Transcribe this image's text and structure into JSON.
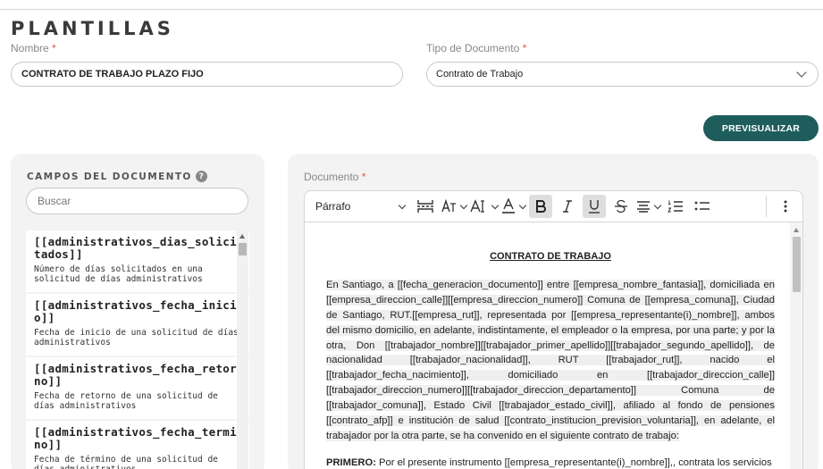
{
  "page": {
    "title": "PLANTILLAS"
  },
  "form": {
    "name_label": "Nombre",
    "required_mark": "*",
    "name_value": "CONTRATO DE TRABAJO PLAZO FIJO",
    "doc_type_label": "Tipo de Documento",
    "doc_type_value": "Contrato de Trabajo"
  },
  "actions": {
    "preview_label": "PREVISUALIZAR"
  },
  "fields_panel": {
    "title": "CAMPOS DEL DOCUMENTO",
    "help_icon": "?",
    "search_placeholder": "Buscar",
    "items": [
      {
        "name": "[[administrativos_dias_solicitados]]",
        "description": "Número de días solicitados en una solicitud de días administrativos"
      },
      {
        "name": "[[administrativos_fecha_inicio]]",
        "description": "Fecha de inicio de una solicitud de días administrativos"
      },
      {
        "name": "[[administrativos_fecha_retorno]]",
        "description": "Fecha de retorno de una solicitud de días administrativos"
      },
      {
        "name": "[[administrativos_fecha_termino]]",
        "description": "Fecha de término de una solicitud de días administrativos"
      }
    ]
  },
  "document": {
    "label": "Documento",
    "toolbar": {
      "format_select": "Párrafo",
      "icons": [
        "page-break-icon",
        "font-size-icon",
        "font-family-icon",
        "font-color-icon",
        "bold-icon",
        "italic-icon",
        "underline-icon",
        "strikethrough-icon",
        "align-icon",
        "numbered-list-icon",
        "bullet-list-icon",
        "more-icon"
      ]
    },
    "title": "CONTRATO DE TRABAJO",
    "paragraph1": "En Santiago, a [[fecha_generacion_documento]] entre [[empresa_nombre_fantasia]], domiciliada en [[empresa_direccion_calle]][[empresa_direccion_numero]] Comuna de [[empresa_comuna]], Ciudad de Santiago, RUT.[[empresa_rut]], representada por [[empresa_representante(i)_nombre]], ambos del mismo domicilio, en adelante, indistintamente, el empleador o la empresa, por una parte; y por la otra, Don [[trabajador_nombre]][[trabajador_primer_apellido]][[trabajador_segundo_apellido]], de nacionalidad [[trabajador_nacionalidad]], RUT [[trabajador_rut]], nacido el [[trabajador_fecha_nacimiento]], domiciliado en [[trabajador_direccion_calle]][[trabajador_direccion_numero]][[trabajador_direccion_departamento]] Comuna de [[trabajador_comuna]], Estado Civil [[trabajador_estado_civil]], afiliado al fondo de pensiones [[contrato_afp]] e institución de salud [[contrato_institucion_prevision_voluntaria]], en adelante, el trabajador por la otra parte, se ha convenido en el siguiente contrato de trabajo:",
    "paragraph2_lead": "PRIMERO:",
    "paragraph2": " Por el presente instrumento [[empresa_representante(i)_nombre]],, contrata los servicios"
  }
}
